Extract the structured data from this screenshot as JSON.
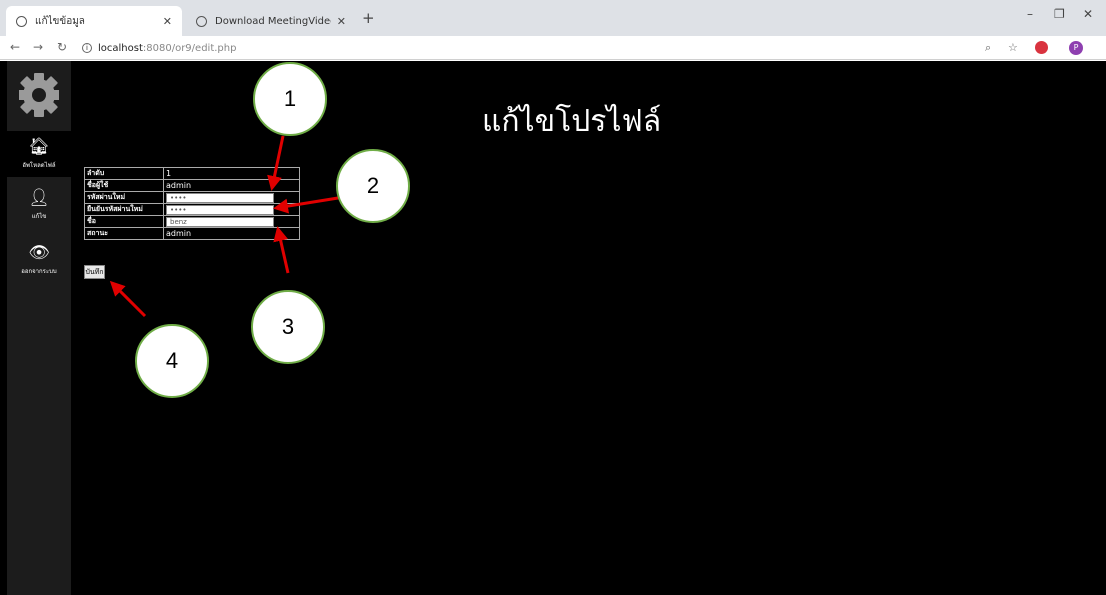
{
  "browser": {
    "tabs": [
      {
        "title": "แก้ไขข้อมูล",
        "active": true
      },
      {
        "title": "Download MeetingVideo",
        "active": false
      }
    ],
    "url_host": "localhost",
    "url_path": ":8080/or9/edit.php",
    "profile_initial": "P"
  },
  "sidebar": {
    "items": [
      {
        "label": "อัพโหลดไฟล์",
        "icon": "home-icon"
      },
      {
        "label": "แก้ไข",
        "icon": "user-icon"
      },
      {
        "label": "ออกจากระบบ",
        "icon": "eye-icon"
      }
    ]
  },
  "page": {
    "heading": "แก้ไขโปรไฟล์"
  },
  "form": {
    "rows": [
      {
        "label": "ลำดับ",
        "value": "1"
      },
      {
        "label": "ชื่อผู้ใช้",
        "value": "admin"
      },
      {
        "label": "รหัสผ่านใหม่",
        "value": "••••"
      },
      {
        "label": "ยืนยันรหัสผ่านใหม่",
        "value": "••••"
      },
      {
        "label": "ชื่อ",
        "value": "benz"
      },
      {
        "label": "สถานะ",
        "value": "admin"
      }
    ],
    "save_label": "บันทึก"
  },
  "annotations": {
    "labels": [
      "1",
      "2",
      "3",
      "4"
    ],
    "circle_border": "#70ad47",
    "arrow_color": "#e00000"
  }
}
